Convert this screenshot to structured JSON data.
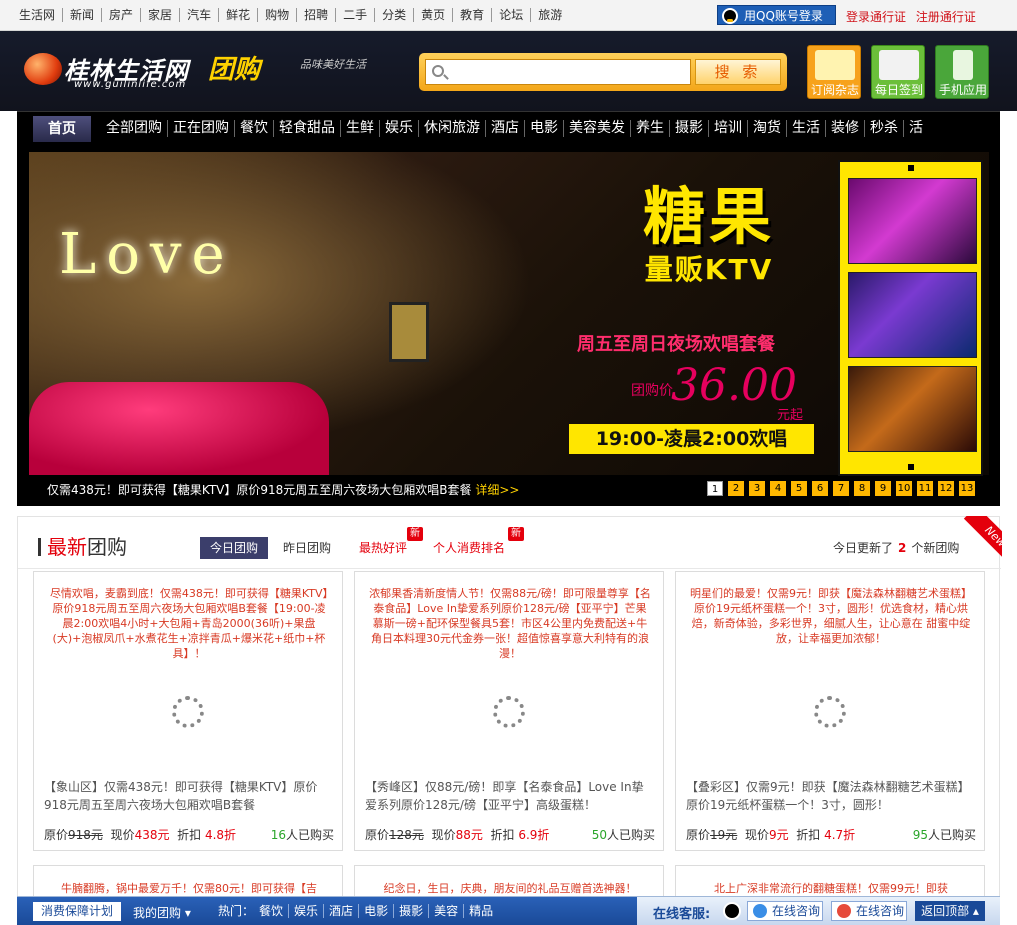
{
  "topbar": {
    "nav": [
      "生活网",
      "新闻",
      "房产",
      "家居",
      "汽车",
      "鲜花",
      "购物",
      "招聘",
      "二手",
      "分类",
      "黄页",
      "教育",
      "论坛",
      "旅游"
    ],
    "qq_login": "用QQ账号登录",
    "login": "登录通行证",
    "register": "注册通行证"
  },
  "header": {
    "logo_name": "桂林生活网",
    "logo_tuan": "团购",
    "logo_url": "www.guilinlife.com",
    "slogan": "品味美好生活",
    "search_placeholder": "",
    "search_button": "搜 索",
    "apps": [
      {
        "label": "订阅杂志",
        "color": "#f7a21b"
      },
      {
        "label": "每日签到",
        "color": "#6bbf3a"
      },
      {
        "label": "手机应用",
        "color": "#4aa63a"
      }
    ]
  },
  "mainnav": {
    "home": "首页",
    "items": [
      "全部团购",
      "正在团购",
      "餐饮",
      "轻食甜品",
      "生鲜",
      "娱乐",
      "休闲旅游",
      "酒店",
      "电影",
      "美容美发",
      "养生",
      "摄影",
      "培训",
      "淘货",
      "生活",
      "装修",
      "秒杀",
      "活"
    ]
  },
  "banner": {
    "love": "Love",
    "brand_title": "糖果",
    "brand_sub": "量贩KTV",
    "promo": "周五至周日夜场欢唱套餐",
    "price_label": "团购价",
    "price": "36.00",
    "price_suffix": "元起",
    "time": "19:00-凌晨2:00欢唱",
    "caption": "仅需438元！即可获得【糖果KTV】原价918元周五至周六夜场大包厢欢唱B套餐",
    "caption_more": "详细>>",
    "pages": [
      "1",
      "2",
      "3",
      "4",
      "5",
      "6",
      "7",
      "8",
      "9",
      "10",
      "11",
      "12",
      "13"
    ],
    "active_page": "1"
  },
  "section": {
    "title_prefix": "最新",
    "title_suffix": "团购",
    "tabs": [
      "今日团购",
      "昨日团购",
      "最热好评",
      "个人消费排名"
    ],
    "badge": "新",
    "updated_prefix": "今日更新了",
    "updated_count": "2",
    "updated_suffix": "个新团购",
    "corner": "New"
  },
  "cards": [
    {
      "desc": "尽情欢唱，麦霸到底！仅需438元！即可获得【糖果KTV】原价918元周五至周六夜场大包厢欢唱B套餐【19:00-凌晨2:00欢唱4小时+大包厢+青岛2000(36听)+果盘(大)+泡椒凤爪+水煮花生+凉拌青瓜+爆米花+纸巾+杯具】！",
      "sub": "【象山区】仅需438元！即可获得【糖果KTV】原价918元周五至周六夜场大包厢欢唱B套餐",
      "orig_label": "原价",
      "orig": "918元",
      "now_label": "现价",
      "now": "438元",
      "disc_label": "折扣",
      "disc": "4.8折",
      "bought": "16",
      "bought_suffix": "人已购买"
    },
    {
      "desc": "浓郁果香清新度情人节！仅需88元/磅！即可限量尊享【名泰食品】Love In挚爱系列原价128元/磅【亚平宁】芒果慕斯一磅+配环保型餐具5套！市区4公里内免费配送+牛角日本料理30元代金券一张！超值惊喜享意大利特有的浪漫！",
      "sub": "【秀峰区】仅88元/磅！即享【名泰食品】Love In挚爱系列原价128元/磅【亚平宁】高级蛋糕！",
      "orig_label": "原价",
      "orig": "128元",
      "now_label": "现价",
      "now": "88元",
      "disc_label": "折扣",
      "disc": "6.9折",
      "bought": "50",
      "bought_suffix": "人已购买"
    },
    {
      "desc": "明星们的最爱！仅需9元！即获【魔法森林翻糖艺术蛋糕】原价19元纸杯蛋糕一个！3寸，圆形！优选食材，精心烘焙，新奇体验，多彩世界，细腻人生，让心意在 甜蜜中绽放，让幸福更加浓郁！",
      "sub": "【叠彩区】仅需9元！即获【魔法森林翻糖艺术蛋糕】原价19元纸杯蛋糕一个！3寸，圆形！",
      "orig_label": "原价",
      "orig": "19元",
      "now_label": "现价",
      "now": "9元",
      "disc_label": "折扣",
      "disc": "4.7折",
      "bought": "95",
      "bought_suffix": "人已购买"
    }
  ],
  "cards_row2": [
    {
      "desc": "牛腩翻腾，锅中最爱万千！仅需80元！即可获得【吉"
    },
    {
      "desc": "纪念日，生日，庆典，朋友间的礼品互赠首选神器！"
    },
    {
      "desc": "北上广深非常流行的翻糖蛋糕！仅需99元！即获"
    }
  ],
  "bottombar": {
    "guarantee": "消费保障计划",
    "mygroup": "我的团购",
    "hot_label": "热门：",
    "hot": [
      "餐饮",
      "娱乐",
      "酒店",
      "电影",
      "摄影",
      "美容",
      "精品"
    ],
    "cs": "在线客服:",
    "consult": "在线咨询",
    "backtop": "返回顶部"
  }
}
